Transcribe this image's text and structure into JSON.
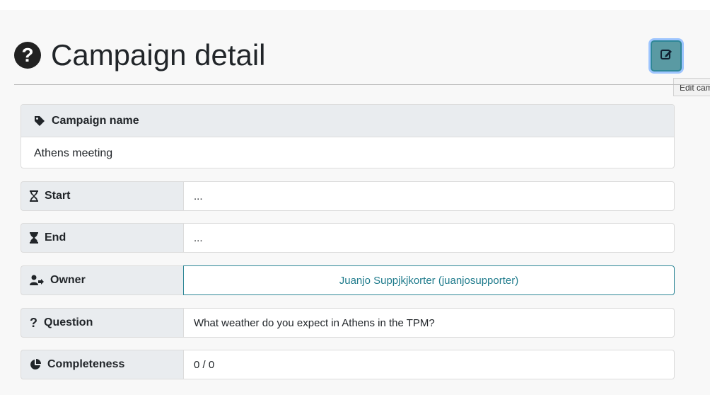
{
  "header": {
    "title": "Campaign detail",
    "edit_tooltip": "Edit campaign"
  },
  "campaign_name": {
    "label": "Campaign name",
    "value": "Athens meeting"
  },
  "fields": {
    "start": {
      "label": "Start",
      "value": "..."
    },
    "end": {
      "label": "End",
      "value": "..."
    },
    "owner": {
      "label": "Owner",
      "value": "Juanjo Suppjkjkorter (juanjosupporter)"
    },
    "question": {
      "label": "Question",
      "value": "What weather do you expect in Athens in the TPM?"
    },
    "completeness": {
      "label": "Completeness",
      "value": "0 / 0"
    }
  },
  "colors": {
    "accent": "#2f8797",
    "link": "#1f7b8c",
    "label_bg": "#e9ecef"
  },
  "icons": [
    "question-circle-icon",
    "edit-icon",
    "tag-icon",
    "hourglass-start-icon",
    "hourglass-end-icon",
    "user-share-icon",
    "question-icon",
    "pie-chart-icon"
  ]
}
